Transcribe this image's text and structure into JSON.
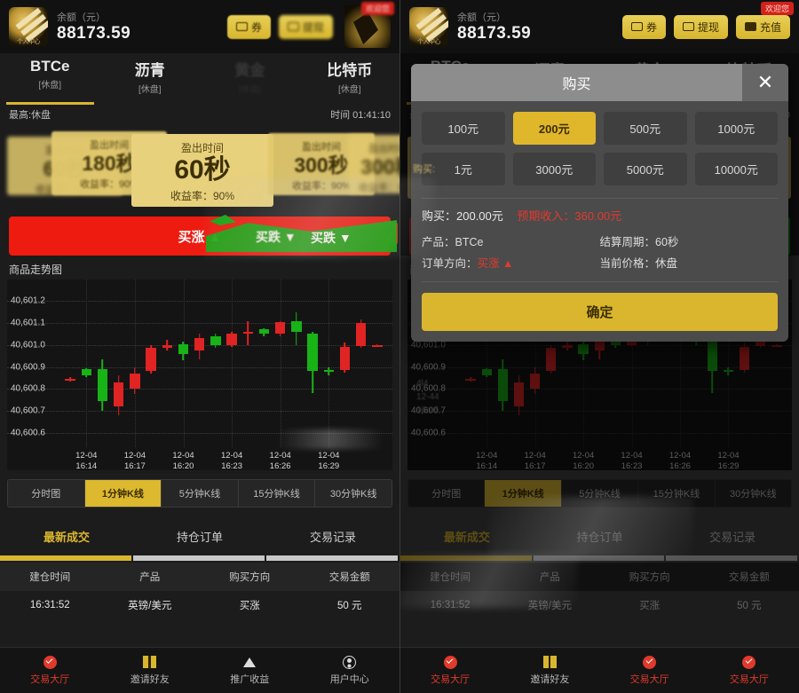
{
  "header": {
    "balance_label": "余额（元）",
    "balance_value": "88173.59",
    "logo_text": "个人中心",
    "buttons": [
      {
        "label": "券",
        "icon": "coupon-icon"
      },
      {
        "label": "提现",
        "icon": "withdraw-icon"
      },
      {
        "label": "充值",
        "icon": "recharge-icon"
      }
    ],
    "welcome_badge": "欢迎您"
  },
  "tabs": [
    {
      "name": "BTCe",
      "status": "[休盘]",
      "active": true
    },
    {
      "name": "沥青",
      "status": "[休盘]",
      "active": false
    },
    {
      "name": "黄金",
      "status": "[休盘]",
      "active": false
    },
    {
      "name": "比特币",
      "status": "[休盘]",
      "active": false
    }
  ],
  "price_row": {
    "high_label": "最高:休盘",
    "time_label": "时间 01:41:10"
  },
  "durations": {
    "label": "盈出时间",
    "rate_label": "收益率：90%",
    "cards": [
      {
        "seconds": "60秒",
        "rate": "收益率：90%"
      },
      {
        "seconds": "180秒",
        "rate": "收益率：90%"
      },
      {
        "seconds": "300秒",
        "rate": "收益率：90%"
      }
    ]
  },
  "trade_buttons": {
    "up": "买涨 ▲",
    "down": "买跌 ▼"
  },
  "chart_section": {
    "title": "商品走势图"
  },
  "chart_data": {
    "type": "candlestick",
    "title": "商品走势图",
    "xlabel": "",
    "ylabel": "",
    "ylim": [
      40600.55,
      40601.25
    ],
    "yticks": [
      "40,601.2",
      "40,601.1",
      "40,601.0",
      "40,600.9",
      "40,600.8",
      "40,600.7",
      "40,600.6"
    ],
    "xticks": [
      "12-04 16:14",
      "12-04 16:17",
      "12-04 16:20",
      "12-04 16:23",
      "12-04 16:26",
      "12-04 16:29"
    ],
    "grid": true,
    "up_color": "#17b317",
    "down_color": "#e02323",
    "candles": [
      {
        "o": 40600.845,
        "h": 40600.855,
        "l": 40600.835,
        "c": 40600.84,
        "dir": "down"
      },
      {
        "o": 40600.86,
        "h": 40600.895,
        "l": 40600.855,
        "c": 40600.89,
        "dir": "up"
      },
      {
        "o": 40600.89,
        "h": 40600.935,
        "l": 40600.7,
        "c": 40600.745,
        "dir": "up"
      },
      {
        "o": 40600.83,
        "h": 40600.86,
        "l": 40600.68,
        "c": 40600.72,
        "dir": "down"
      },
      {
        "o": 40600.8,
        "h": 40600.9,
        "l": 40600.775,
        "c": 40600.87,
        "dir": "down"
      },
      {
        "o": 40600.88,
        "h": 40601.0,
        "l": 40600.87,
        "c": 40600.985,
        "dir": "down"
      },
      {
        "o": 40600.985,
        "h": 40601.025,
        "l": 40600.975,
        "c": 40601.0,
        "dir": "down"
      },
      {
        "o": 40600.96,
        "h": 40601.015,
        "l": 40600.93,
        "c": 40601.005,
        "dir": "up"
      },
      {
        "o": 40600.975,
        "h": 40601.05,
        "l": 40600.935,
        "c": 40601.03,
        "dir": "down"
      },
      {
        "o": 40601.0,
        "h": 40601.05,
        "l": 40600.985,
        "c": 40601.04,
        "dir": "up"
      },
      {
        "o": 40601.0,
        "h": 40601.06,
        "l": 40600.99,
        "c": 40601.05,
        "dir": "down"
      },
      {
        "o": 40601.055,
        "h": 40601.11,
        "l": 40601.0,
        "c": 40601.06,
        "dir": "down"
      },
      {
        "o": 40601.05,
        "h": 40601.075,
        "l": 40601.04,
        "c": 40601.07,
        "dir": "up"
      },
      {
        "o": 40601.05,
        "h": 40601.11,
        "l": 40601.04,
        "c": 40601.105,
        "dir": "down"
      },
      {
        "o": 40601.11,
        "h": 40601.15,
        "l": 40601.0,
        "c": 40601.06,
        "dir": "up"
      },
      {
        "o": 40601.05,
        "h": 40601.06,
        "l": 40600.78,
        "c": 40600.88,
        "dir": "up"
      },
      {
        "o": 40600.88,
        "h": 40600.9,
        "l": 40600.86,
        "c": 40600.885,
        "dir": "up"
      },
      {
        "o": 40600.885,
        "h": 40601.01,
        "l": 40600.875,
        "c": 40600.99,
        "dir": "down"
      },
      {
        "o": 40600.995,
        "h": 40601.115,
        "l": 40600.985,
        "c": 40601.1,
        "dir": "down"
      },
      {
        "o": 40601.0,
        "h": 40601.005,
        "l": 40600.995,
        "c": 40601.0,
        "dir": "down"
      }
    ]
  },
  "periods": [
    {
      "label": "分时图",
      "active": false
    },
    {
      "label": "1分钟K线",
      "active": true
    },
    {
      "label": "5分钟K线",
      "active": false
    },
    {
      "label": "15分钟K线",
      "active": false
    },
    {
      "label": "30分钟K线",
      "active": false
    }
  ],
  "order_tabs": [
    {
      "label": "最新成交",
      "active": true
    },
    {
      "label": "持仓订单",
      "active": false
    },
    {
      "label": "交易记录",
      "active": false
    }
  ],
  "table": {
    "headers": [
      "建仓时间",
      "产品",
      "购买方向",
      "交易金额"
    ],
    "rows": [
      {
        "time": "16:31:52",
        "product": "英镑/美元",
        "direction": "买涨",
        "amount": "50 元"
      }
    ]
  },
  "bottom_nav": [
    {
      "label": "交易大厅",
      "icon": "hall-icon",
      "active": true
    },
    {
      "label": "邀请好友",
      "icon": "gift-icon",
      "active": false
    },
    {
      "label": "推广收益",
      "icon": "tree-icon",
      "active": false
    },
    {
      "label": "用户中心",
      "icon": "user-icon",
      "active": false
    }
  ],
  "bottom_nav_right": [
    {
      "label": "交易大厅",
      "icon": "hall-icon",
      "active": true
    },
    {
      "label": "邀请好友",
      "icon": "gift-icon",
      "active": false
    },
    {
      "label": "交易大厅",
      "icon": "hall-icon",
      "active": true
    },
    {
      "label": "交易大厅",
      "icon": "hall-icon",
      "active": true
    }
  ],
  "modal": {
    "title": "购买",
    "close_icon": "close-icon",
    "amount_options": [
      {
        "label": "100元",
        "selected": false
      },
      {
        "label": "200元",
        "selected": true
      },
      {
        "label": "500元",
        "selected": false
      },
      {
        "label": "1000元",
        "selected": false
      },
      {
        "label": "1元",
        "selected": false
      },
      {
        "label": "3000元",
        "selected": false
      },
      {
        "label": "5000元",
        "selected": false
      },
      {
        "label": "10000元",
        "selected": false
      }
    ],
    "buy_line": "购买：200.00元",
    "income_line": "预期收入：360.00元",
    "product_label": "产品：BTCe",
    "settle_label": "结算周期：60秒",
    "direction_label": "订单方向：",
    "direction_value": "买涨 ▲",
    "price_label": "当前价格：休盘",
    "confirm": "确定",
    "ghost_text": "购买:",
    "ghost_text2": "最"
  },
  "colors": {
    "accent": "#d9b62e",
    "up": "#e02323",
    "down": "#17b317",
    "bg": "#1c1c1c"
  }
}
